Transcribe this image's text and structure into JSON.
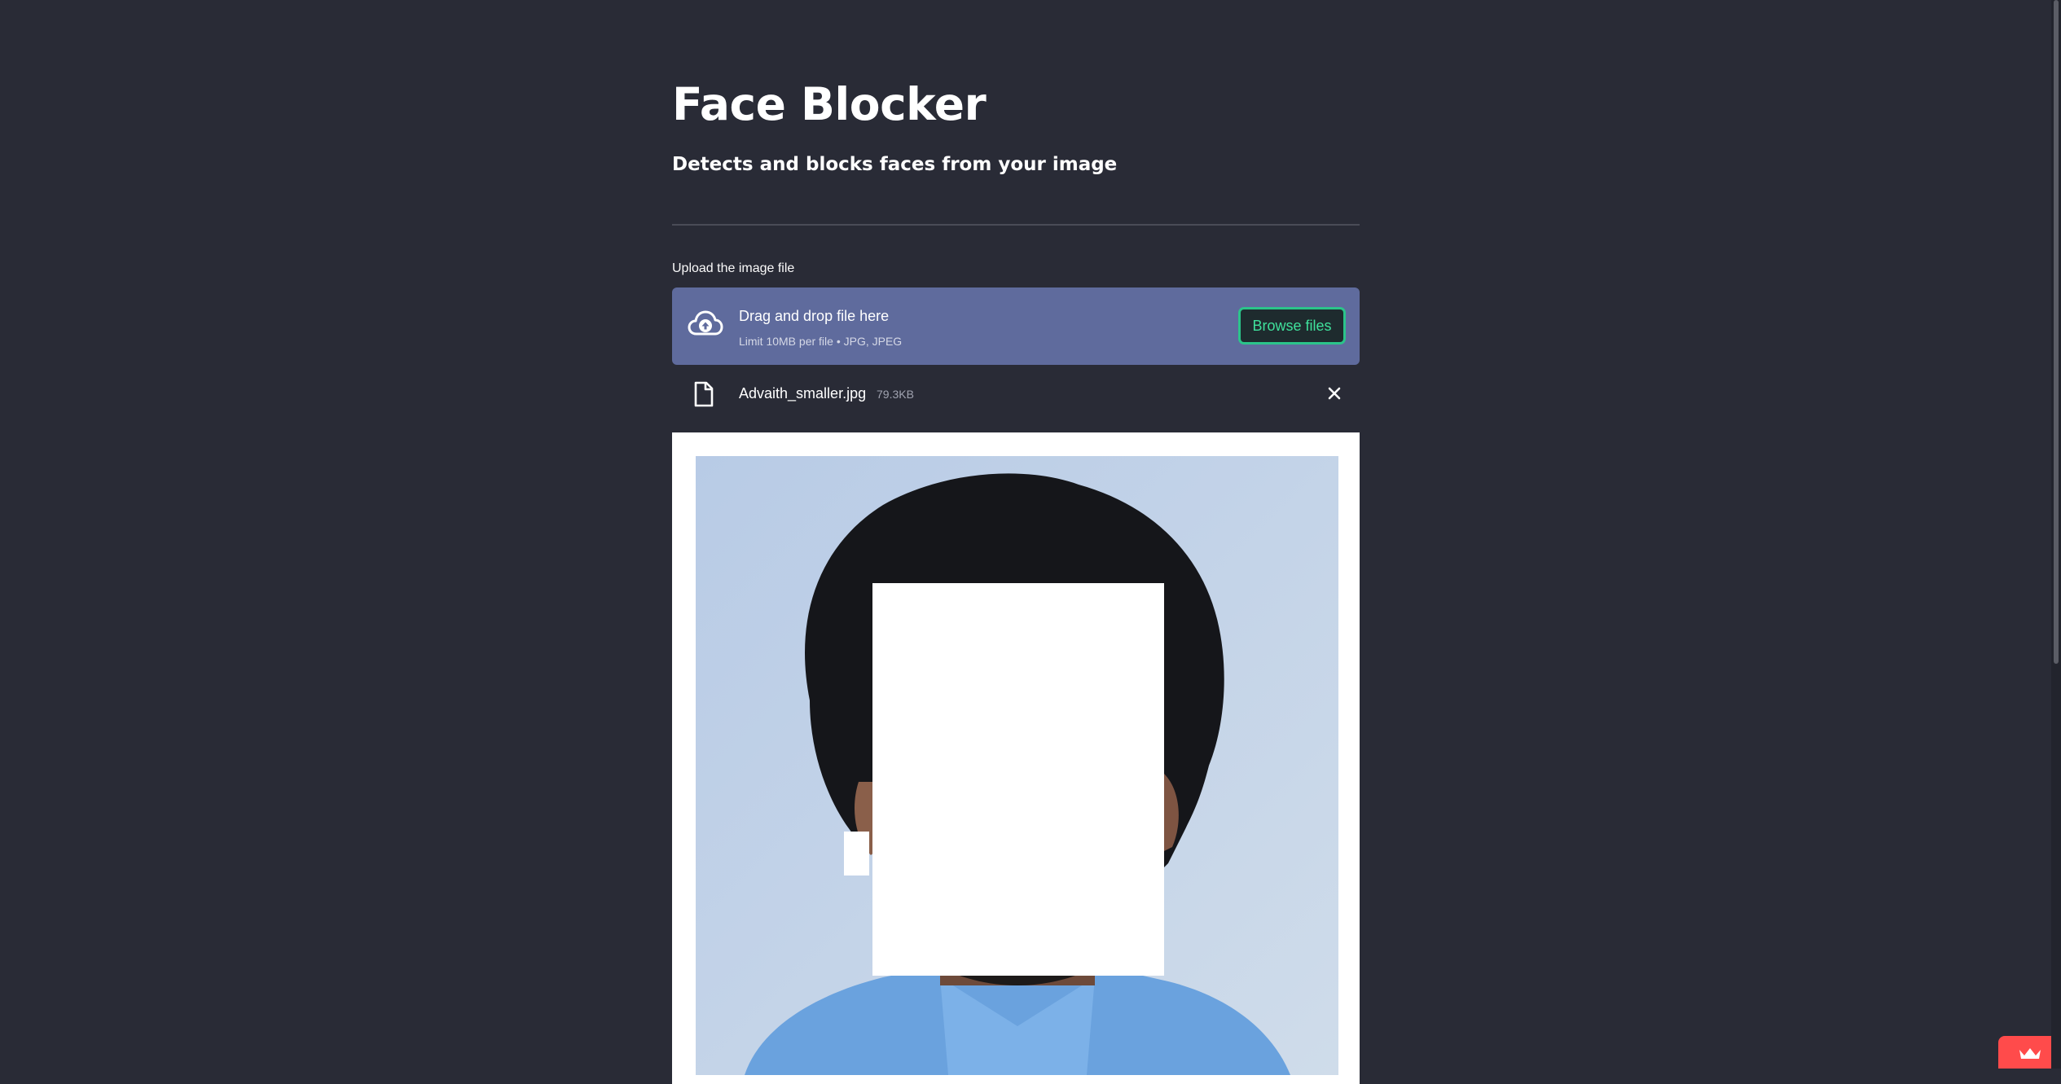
{
  "page": {
    "title": "Face Blocker",
    "subtitle": "Detects and blocks faces from your image"
  },
  "uploader": {
    "label": "Upload the image file",
    "drag_text": "Drag and drop file here",
    "limit_text": "Limit 10MB per file • JPG, JPEG",
    "browse_label": "Browse files",
    "upload_icon": "cloud-upload-icon"
  },
  "uploaded_file": {
    "name": "Advaith_smaller.jpg",
    "size": "79.3KB",
    "file_icon": "file-icon",
    "remove_icon": "close-icon"
  },
  "colors": {
    "background": "#292b36",
    "dropzone": "#5f6b9d",
    "accent_green": "#2bc48a",
    "badge_red": "#ff4b4b"
  },
  "badge": {
    "icon": "crown-icon"
  }
}
